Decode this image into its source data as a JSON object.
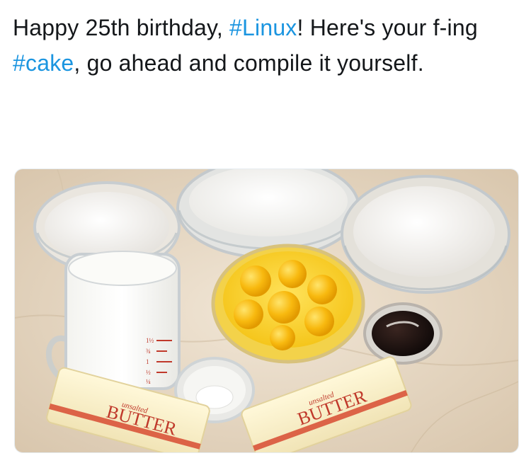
{
  "tweet": {
    "text_parts": {
      "p1": "Happy 25th birthday, ",
      "h1": "#Linux",
      "p2": "! Here's your f-ing ",
      "h2": "#cake",
      "p3": ", go ahead and compile it yourself."
    },
    "hashtag_color": "#1b95e0"
  },
  "media": {
    "butter_left": {
      "top": "unsalted",
      "main": "BUTTER"
    },
    "butter_right": {
      "top": "unsalted",
      "main": "BUTTER"
    },
    "cup_marks": [
      "1½",
      "¾",
      "1",
      "½",
      "¼"
    ]
  }
}
